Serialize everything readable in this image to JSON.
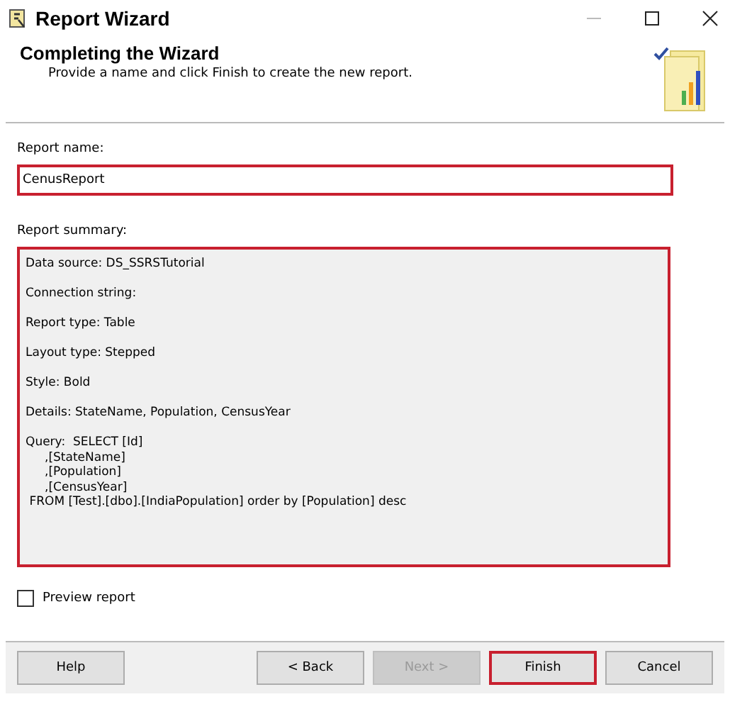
{
  "window": {
    "title": "Report Wizard"
  },
  "header": {
    "title": "Completing the Wizard",
    "subtitle": "Provide a name and click Finish to create the new report."
  },
  "report_name": {
    "label": "Report name:",
    "value": "CenusReport",
    "highlighted": true
  },
  "summary": {
    "label": "Report summary:",
    "highlighted": true,
    "lines": [
      "Data source: DS_SSRSTutorial",
      "Connection string:",
      "Report type: Table",
      "Layout type: Stepped",
      "Style: Bold",
      "Details: StateName, Population, CensusYear",
      "Query:  SELECT [Id]\n     ,[StateName]\n     ,[Population]\n     ,[CensusYear]\n FROM [Test].[dbo].[IndiaPopulation] order by [Population] desc"
    ]
  },
  "preview": {
    "label": "Preview report",
    "checked": false
  },
  "buttons": [
    {
      "label": "Help",
      "disabled": false,
      "highlighted": false
    },
    {
      "label": "< Back",
      "disabled": false,
      "highlighted": false
    },
    {
      "label": "Next >",
      "disabled": true,
      "highlighted": false
    },
    {
      "label": "Finish",
      "disabled": false,
      "highlighted": true
    },
    {
      "label": "Cancel",
      "disabled": false,
      "highlighted": false
    }
  ]
}
